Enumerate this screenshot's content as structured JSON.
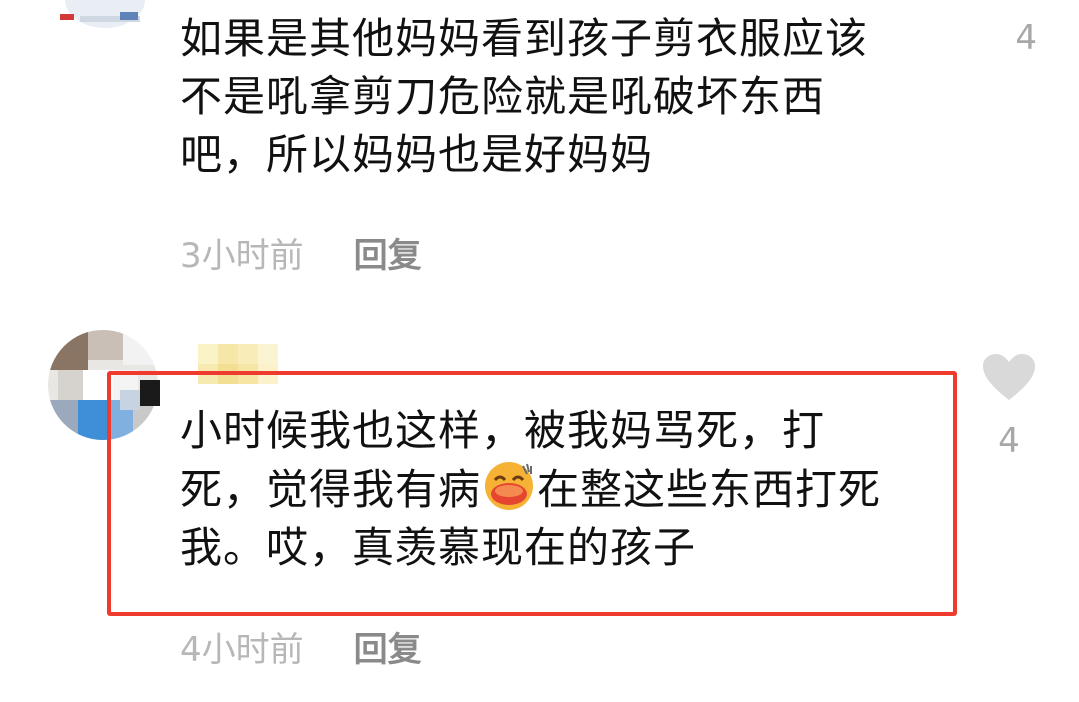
{
  "comments": [
    {
      "text_lines": [
        "如果是其他妈妈看到孩子剪衣服应该",
        "不是吼拿剪刀危险就是吼破坏东西",
        "吧，所以妈妈也是好妈妈"
      ],
      "time": "3小时前",
      "reply_label": "回复",
      "likes": "4"
    },
    {
      "text_line1": "小时候我也这样，被我妈骂死，打",
      "text_line2_before_emoji": "死，觉得我有病",
      "emoji_name": "laughing-crying-emoji",
      "text_line2_after_emoji": "在整这些东西打死",
      "text_line3": "我。哎，真羡慕现在的孩子",
      "time": "4小时前",
      "reply_label": "回复",
      "likes": "4"
    }
  ],
  "colors": {
    "highlight": "#ef3b2d",
    "heart": "#d9d9d9",
    "time": "#b7b7b7",
    "reply": "#8a8a8a"
  }
}
